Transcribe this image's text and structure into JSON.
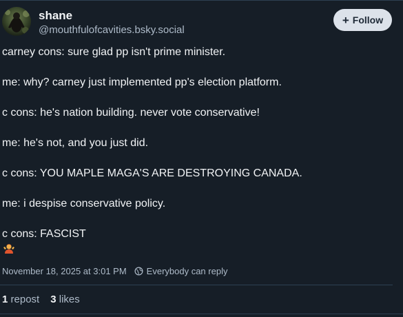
{
  "author": {
    "name": "shane",
    "handle": "@mouthfulofcavities.bsky.social"
  },
  "follow_button": {
    "icon": "plus",
    "label": "Follow"
  },
  "post": {
    "lines": [
      "carney cons: sure glad pp isn't prime minister.",
      "me: why? carney just implemented pp's election platform.",
      "c cons: he's nation building. never vote conservative!",
      "me: he's not, and you just did.",
      "c cons: YOU MAPLE MAGA'S ARE DESTROYING CANADA.",
      "me: i despise conservative policy.",
      "c cons: FASCIST"
    ],
    "emoji": "shrugging-person-emoji"
  },
  "meta": {
    "timestamp": "November 18, 2025 at 3:01 PM",
    "reply_setting": "Everybody can reply"
  },
  "stats": {
    "reposts_count": "1",
    "reposts_label": "repost",
    "likes_count": "3",
    "likes_label": "likes"
  },
  "colors": {
    "background": "#161e27",
    "text": "#f1f3f5",
    "muted": "#aebbc9",
    "button_bg": "#dce2ea"
  }
}
